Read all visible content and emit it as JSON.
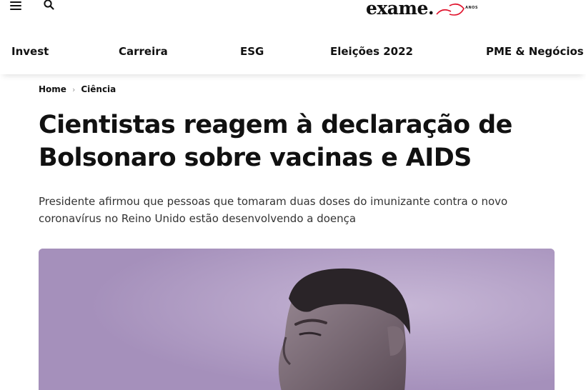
{
  "header": {
    "menu_icon": "hamburger-menu-icon",
    "search_icon": "search-icon",
    "logo": {
      "text": "exame.",
      "badge": "ANOS"
    }
  },
  "nav": {
    "items": [
      "Invest",
      "Carreira",
      "ESG",
      "Eleições 2022",
      "PME & Negócios"
    ]
  },
  "breadcrumb": {
    "home": "Home",
    "separator": "›",
    "section": "Ciência"
  },
  "article": {
    "title": "Cientistas reagem à declaração de Bolsonaro sobre vacinas e AIDS",
    "subtitle": "Presidente afirmou que pessoas que tomaram duas doses do imunizante contra o novo coronavírus no Reino Unido estão desenvolvendo a doença"
  },
  "colors": {
    "accent_logo": "#e0102a",
    "text": "#111111",
    "hero_bg": "#b3a1c7"
  }
}
